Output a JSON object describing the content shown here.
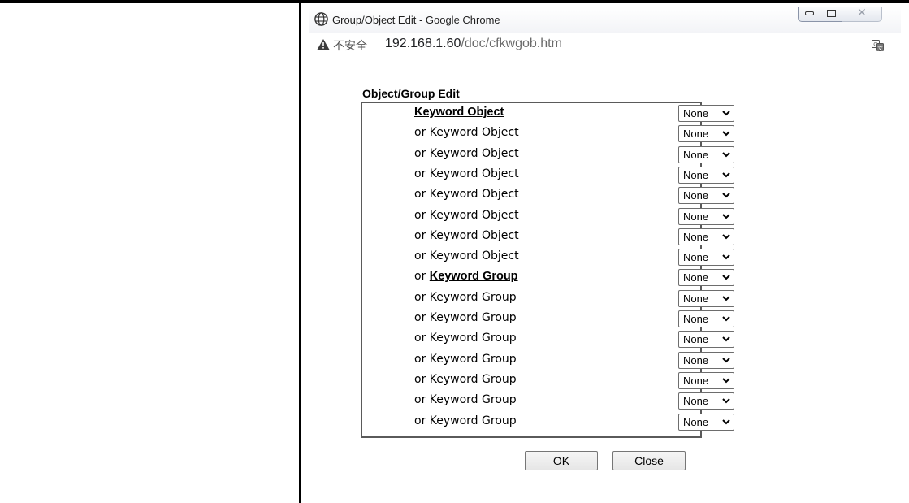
{
  "window": {
    "title": "Group/Object Edit - Google Chrome",
    "close_glyph": "✕"
  },
  "addressbar": {
    "security_label": "不安全",
    "url_host": "192.168.1.60",
    "url_path": "/doc/cfkwgob.htm"
  },
  "form": {
    "heading": "Object/Group Edit",
    "rows": [
      {
        "prefix": "",
        "link": "Keyword Object",
        "text": "",
        "value": "None"
      },
      {
        "prefix": "",
        "link": "",
        "text": "or Keyword Object",
        "value": "None"
      },
      {
        "prefix": "",
        "link": "",
        "text": "or Keyword Object",
        "value": "None"
      },
      {
        "prefix": "",
        "link": "",
        "text": "or Keyword Object",
        "value": "None"
      },
      {
        "prefix": "",
        "link": "",
        "text": "or Keyword Object",
        "value": "None"
      },
      {
        "prefix": "",
        "link": "",
        "text": "or Keyword Object",
        "value": "None"
      },
      {
        "prefix": "",
        "link": "",
        "text": "or Keyword Object",
        "value": "None"
      },
      {
        "prefix": "",
        "link": "",
        "text": "or Keyword Object",
        "value": "None"
      },
      {
        "prefix": "or ",
        "link": "Keyword Group",
        "text": "",
        "value": "None"
      },
      {
        "prefix": "",
        "link": "",
        "text": "or Keyword Group",
        "value": "None"
      },
      {
        "prefix": "",
        "link": "",
        "text": "or Keyword Group",
        "value": "None"
      },
      {
        "prefix": "",
        "link": "",
        "text": "or Keyword Group",
        "value": "None"
      },
      {
        "prefix": "",
        "link": "",
        "text": "or Keyword Group",
        "value": "None"
      },
      {
        "prefix": "",
        "link": "",
        "text": "or Keyword Group",
        "value": "None"
      },
      {
        "prefix": "",
        "link": "",
        "text": "or Keyword Group",
        "value": "None"
      },
      {
        "prefix": "",
        "link": "",
        "text": "or Keyword Group",
        "value": "None"
      }
    ],
    "ok_label": "OK",
    "close_label": "Close"
  },
  "icons": {
    "window_icon": "globe-icon",
    "security": "warning-icon",
    "translate": "translate-icon",
    "dropdown": "chevron-down-icon"
  }
}
